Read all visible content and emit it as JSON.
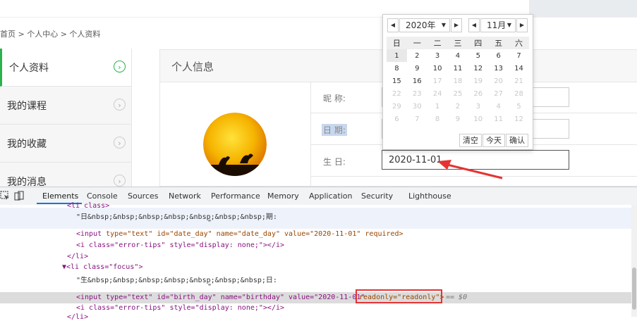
{
  "breadcrumb": "首页 > 个人中心 > 个人资料",
  "sidebar": {
    "items": [
      {
        "label": "个人资料",
        "arrow": "›"
      },
      {
        "label": "我的课程",
        "arrow": "›"
      },
      {
        "label": "我的收藏",
        "arrow": "›"
      },
      {
        "label": "我的消息",
        "arrow": "›"
      }
    ]
  },
  "panel": {
    "title": "个人信息",
    "fields": {
      "nickname_label": "昵      称:",
      "date_label": "日      期:",
      "birthday_label": "生      日:",
      "birthday_value": "2020-11-01"
    }
  },
  "datepicker": {
    "prev": "◀",
    "next": "▶",
    "year": "2020年",
    "month": "11月",
    "caret": "▼",
    "weekdays": [
      "日",
      "一",
      "二",
      "三",
      "四",
      "五",
      "六"
    ],
    "weeks": [
      [
        "1",
        "2",
        "3",
        "4",
        "5",
        "6",
        "7"
      ],
      [
        "8",
        "9",
        "10",
        "11",
        "12",
        "13",
        "14"
      ],
      [
        "15",
        "16",
        "17",
        "18",
        "19",
        "20",
        "21"
      ],
      [
        "22",
        "23",
        "24",
        "25",
        "26",
        "27",
        "28"
      ],
      [
        "29",
        "30",
        "1",
        "2",
        "3",
        "4",
        "5"
      ],
      [
        "6",
        "7",
        "8",
        "9",
        "10",
        "11",
        "12"
      ]
    ],
    "buttons": {
      "clear": "清空",
      "today": "今天",
      "confirm": "确认"
    }
  },
  "devtools": {
    "tabs": [
      "Elements",
      "Console",
      "Sources",
      "Network",
      "Performance",
      "Memory",
      "Application",
      "Security",
      "Lighthouse"
    ],
    "lines": {
      "l0": "<li class>",
      "l1": "\"日&nbsp;&nbsp;&nbsp;&nbsp;&nbsp;&nbsp;&nbsp;期:",
      "l2": "\"",
      "l3_tag_open": "<input",
      "l3_rest": " type=\"text\" id=\"date_day\" name=\"date_day\" value=\"2020-11-01\" required>",
      "l4": "<i class=\"error-tips\" style=\"display: none;\"></i>",
      "l5": "</li>",
      "l6": "▼<li class=\"focus\">",
      "l7": "\"生&nbsp;&nbsp;&nbsp;&nbsp;&nbsp;&nbsp;&nbsp;日:",
      "l8": "\"",
      "l9": "<input type=\"text\" id=\"birth_day\" name=\"birthday\" value=\"2020-11-01\"",
      "l9_readonly": "readonly=\"readonly\">",
      "l9_eq": "== $0",
      "l10": "<i class=\"error-tips\" style=\"display: none;\"></i>",
      "l11": "</li>"
    }
  },
  "colors": {
    "accent_green": "#2bb24c",
    "devtools_blue": "#1a73e8",
    "annotation_red": "#e53333"
  }
}
